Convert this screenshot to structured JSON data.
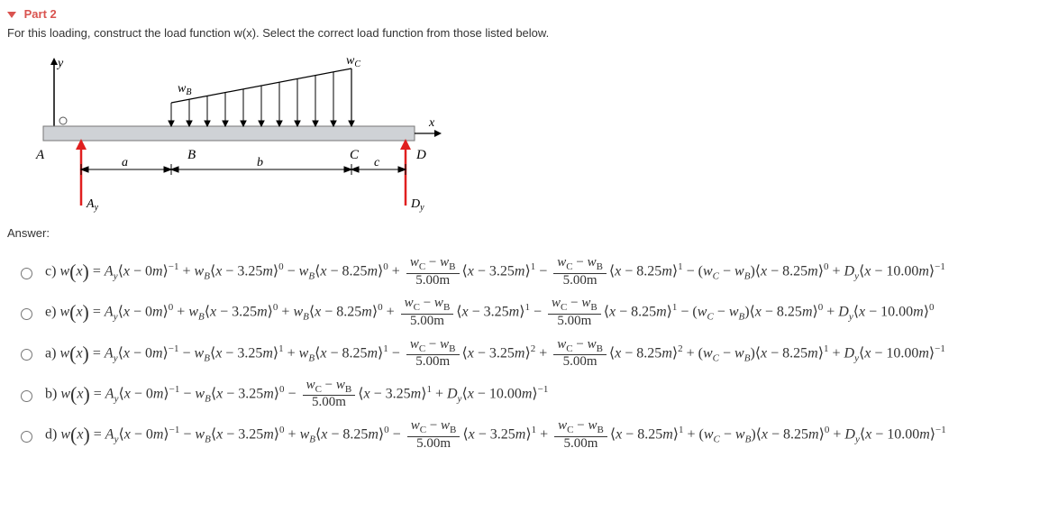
{
  "header": {
    "part": "Part 2"
  },
  "question": "For this loading, construct the load function w(x).  Select the correct load function from those listed below.",
  "diagram": {
    "yLabel": "y",
    "xLabel": "x",
    "wB": "wB",
    "wC": "wC",
    "A": "A",
    "B": "B",
    "C": "C",
    "D": "D",
    "a": "a",
    "b": "b",
    "c": "c",
    "Ay": "Ay",
    "Dy": "Dy"
  },
  "answerLabel": "Answer:",
  "options": [
    {
      "letter": "c)",
      "terms": [
        "= ",
        "A",
        "y",
        "⟨",
        "x",
        " − 0",
        "m",
        "⟩",
        "−1",
        " + ",
        "w",
        "B",
        "⟨",
        "x",
        " − 3.25",
        "m",
        "⟩",
        "0",
        " − ",
        "w",
        "B",
        "⟨",
        "x",
        " − 8.25",
        "m",
        "⟩",
        "0",
        " + ",
        "FRAC",
        "⟨",
        "x",
        " − 3.25",
        "m",
        "⟩",
        "1",
        " − ",
        "FRAC",
        "⟨",
        "x",
        " − 8.25",
        "m",
        "⟩",
        "1",
        " − (",
        "w",
        "C",
        " − ",
        "w",
        "B",
        ")⟨",
        "x",
        " − 8.25",
        "m",
        "⟩",
        "0",
        " + ",
        "D",
        "y",
        "⟨",
        "x",
        " − 10.00",
        "m",
        "⟩",
        "−1"
      ]
    },
    {
      "letter": "e)",
      "terms": [
        "= ",
        "A",
        "y",
        "⟨",
        "x",
        " − 0",
        "m",
        "⟩",
        "0",
        " + ",
        "w",
        "B",
        "⟨",
        "x",
        " − 3.25",
        "m",
        "⟩",
        "0",
        " + ",
        "w",
        "B",
        "⟨",
        "x",
        " − 8.25",
        "m",
        "⟩",
        "0",
        " + ",
        "FRAC",
        "⟨",
        "x",
        " − 3.25",
        "m",
        "⟩",
        "1",
        " − ",
        "FRAC",
        "⟨",
        "x",
        " − 8.25",
        "m",
        "⟩",
        "1",
        " − (",
        "w",
        "C",
        " − ",
        "w",
        "B",
        ")⟨",
        "x",
        " − 8.25",
        "m",
        "⟩",
        "0",
        " + ",
        "D",
        "y",
        "⟨",
        "x",
        " − 10.00",
        "m",
        "⟩",
        "0"
      ]
    },
    {
      "letter": "a)",
      "terms": [
        "= ",
        "A",
        "y",
        "⟨",
        "x",
        " − 0",
        "m",
        "⟩",
        "−1",
        " − ",
        "w",
        "B",
        "⟨",
        "x",
        " − 3.25",
        "m",
        "⟩",
        "1",
        " + ",
        "w",
        "B",
        "⟨",
        "x",
        " − 8.25",
        "m",
        "⟩",
        "1",
        " − ",
        "FRAC",
        "⟨",
        "x",
        " − 3.25",
        "m",
        "⟩",
        "2",
        " + ",
        "FRAC",
        "⟨",
        "x",
        " − 8.25",
        "m",
        "⟩",
        "2",
        " + (",
        "w",
        "C",
        " − ",
        "w",
        "B",
        ")⟨",
        "x",
        " − 8.25",
        "m",
        "⟩",
        "1",
        " + ",
        "D",
        "y",
        "⟨",
        "x",
        " − 10.00",
        "m",
        "⟩",
        "−1"
      ]
    },
    {
      "letter": "b)",
      "terms": [
        "= ",
        "A",
        "y",
        "⟨",
        "x",
        " − 0",
        "m",
        "⟩",
        "−1",
        " − ",
        "w",
        "B",
        "⟨",
        "x",
        " − 3.25",
        "m",
        "⟩",
        "0",
        " − ",
        "FRAC",
        "⟨",
        "x",
        " − 3.25",
        "m",
        "⟩",
        "1",
        " + ",
        "D",
        "y",
        "⟨",
        "x",
        " − 10.00",
        "m",
        "⟩",
        "−1"
      ]
    },
    {
      "letter": "d)",
      "terms": [
        "= ",
        "A",
        "y",
        "⟨",
        "x",
        " − 0",
        "m",
        "⟩",
        "−1",
        " − ",
        "w",
        "B",
        "⟨",
        "x",
        " − 3.25",
        "m",
        "⟩",
        "0",
        " + ",
        "w",
        "B",
        "⟨",
        "x",
        " − 8.25",
        "m",
        "⟩",
        "0",
        " − ",
        "FRAC",
        "⟨",
        "x",
        " − 3.25",
        "m",
        "⟩",
        "1",
        " + ",
        "FRAC",
        "⟨",
        "x",
        " − 8.25",
        "m",
        "⟩",
        "1",
        " + (",
        "w",
        "C",
        " − ",
        "w",
        "B",
        ")⟨",
        "x",
        " − 8.25",
        "m",
        "⟩",
        "0",
        " + ",
        "D",
        "y",
        "⟨",
        "x",
        " − 10.00",
        "m",
        "⟩",
        "−1"
      ]
    }
  ],
  "frac": {
    "num": [
      "w",
      "C",
      " − ",
      "w",
      "B"
    ],
    "den": "5.00m"
  },
  "wx": [
    "w",
    "(",
    "x",
    ") "
  ]
}
